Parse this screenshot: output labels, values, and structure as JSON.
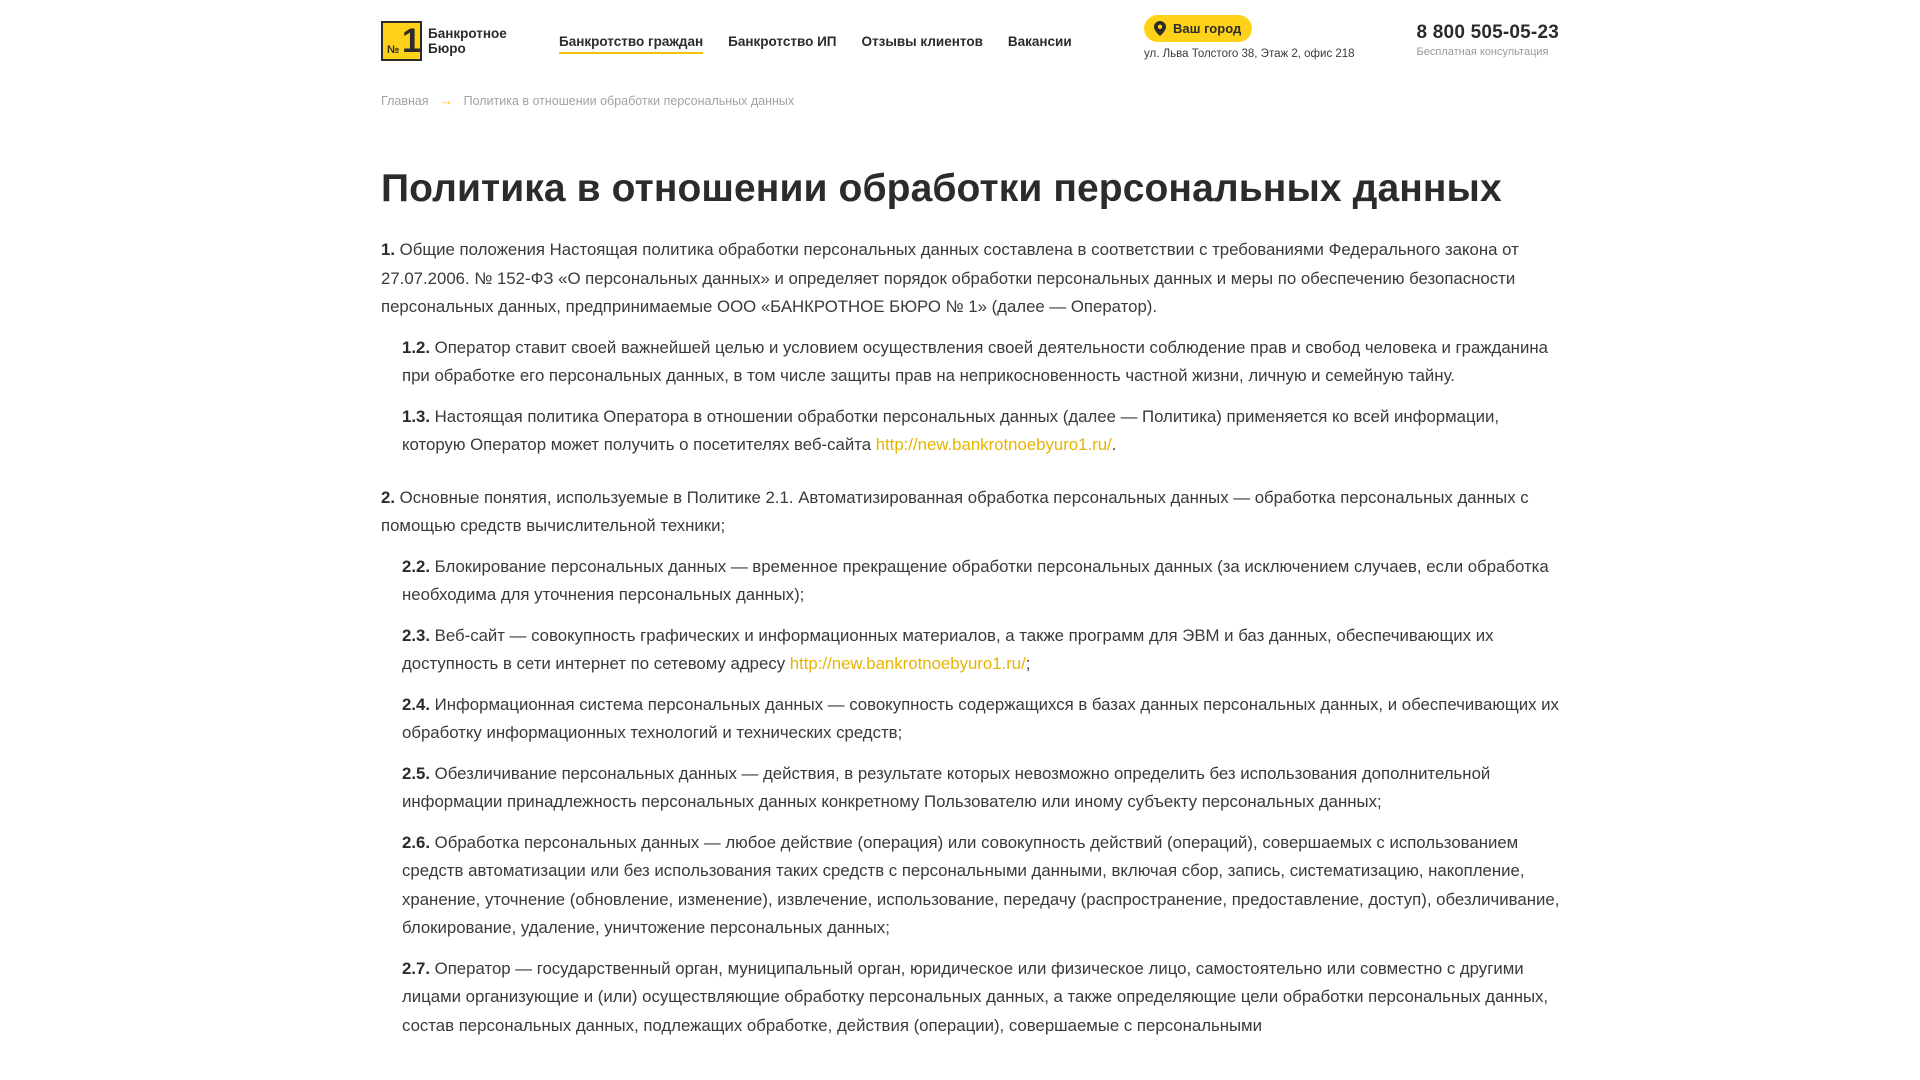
{
  "header": {
    "logo_line1": "Банкротное",
    "logo_line2": "Бюро",
    "logo_no": "№",
    "logo_one": "1",
    "nav": [
      {
        "label": "Банкротство граждан",
        "active": true
      },
      {
        "label": "Банкротство ИП",
        "active": false
      },
      {
        "label": "Отзывы клиентов",
        "active": false
      },
      {
        "label": "Вакансии",
        "active": false
      }
    ],
    "city_button": "Ваш город",
    "address": "ул. Льва Толстого 38, Этаж 2, офис 218",
    "phone": "8 800 505-05-23",
    "phone_note": "Бесплатная консультация"
  },
  "breadcrumb": {
    "home": "Главная",
    "current": "Политика в отношении обработки персональных данных"
  },
  "page_title": "Политика в отношении обработки персональных данных",
  "paragraphs": [
    {
      "num": "1.",
      "text": "Общие положения Настоящая политика обработки персональных данных составлена в соответствии с требованиями Федерального закона от 27.07.2006. № 152-ФЗ «О персональных данных» и определяет порядок обработки персональных данных и меры по обеспечению безопасности персональных данных, предпринимаемые ООО «БАНКРОТНОЕ БЮРО № 1» (далее — Оператор).",
      "link": "",
      "after": ""
    },
    {
      "num": "1.2.",
      "text": "Оператор ставит своей важнейшей целью и условием осуществления своей деятельности соблюдение прав и свобод человека и гражданина при обработке его персональных данных, в том числе защиты прав на неприкосновенность частной жизни, личную и семейную тайну.",
      "link": "",
      "after": ""
    },
    {
      "num": "1.3.",
      "text": "Настоящая политика Оператора в отношении обработки персональных данных (далее — Политика) применяется ко всей информации, которую Оператор может получить о посетителях веб-сайта ",
      "link": "http://new.bankrotnoebyuro1.ru/",
      "after": "."
    },
    {
      "num": "2.",
      "text": "Основные понятия, используемые в Политике 2.1. Автоматизированная обработка персональных данных — обработка персональных данных с помощью средств вычислительной техники;",
      "link": "",
      "after": ""
    },
    {
      "num": "2.2.",
      "text": "Блокирование персональных данных — временное прекращение обработки персональных данных (за исключением случаев, если обработка необходима для уточнения персональных данных);",
      "link": "",
      "after": ""
    },
    {
      "num": "2.3.",
      "text": "Веб-сайт — совокупность графических и информационных материалов, а также программ для ЭВМ и баз данных, обеспечивающих их доступность в сети интернет по сетевому адресу ",
      "link": "http://new.bankrotnoebyuro1.ru/",
      "after": ";"
    },
    {
      "num": "2.4.",
      "text": "Информационная система персональных данных — совокупность содержащихся в базах данных персональных данных, и обеспечивающих их обработку информационных технологий и технических средств;",
      "link": "",
      "after": ""
    },
    {
      "num": "2.5.",
      "text": "Обезличивание персональных данных — действия, в результате которых невозможно определить без использования дополнительной информации принадлежность персональных данных конкретному Пользователю или иному субъекту персональных данных;",
      "link": "",
      "after": ""
    },
    {
      "num": "2.6.",
      "text": "Обработка персональных данных — любое действие (операция) или совокупность действий (операций), совершаемых с использованием средств автоматизации или без использования таких средств с персональными данными, включая сбор, запись, систематизацию, накопление, хранение, уточнение (обновление, изменение), извлечение, использование, передачу (распространение, предоставление, доступ), обезличивание, блокирование, удаление, уничтожение персональных данных;",
      "link": "",
      "after": ""
    },
    {
      "num": "2.7.",
      "text": "Оператор — государственный орган, муниципальный орган, юридическое или физическое лицо, самостоятельно или совместно с другими лицами организующие и (или) осуществляющие обработку персональных данных, а также определяющие цели обработки персональных данных, состав персональных данных, подлежащих обработке, действия (операции), совершаемые с персональными",
      "link": "",
      "after": ""
    }
  ],
  "colors": {
    "accent": "#ffd21a",
    "link": "#e8b400",
    "text": "#2b2b2b",
    "muted": "#a3a3a3"
  }
}
